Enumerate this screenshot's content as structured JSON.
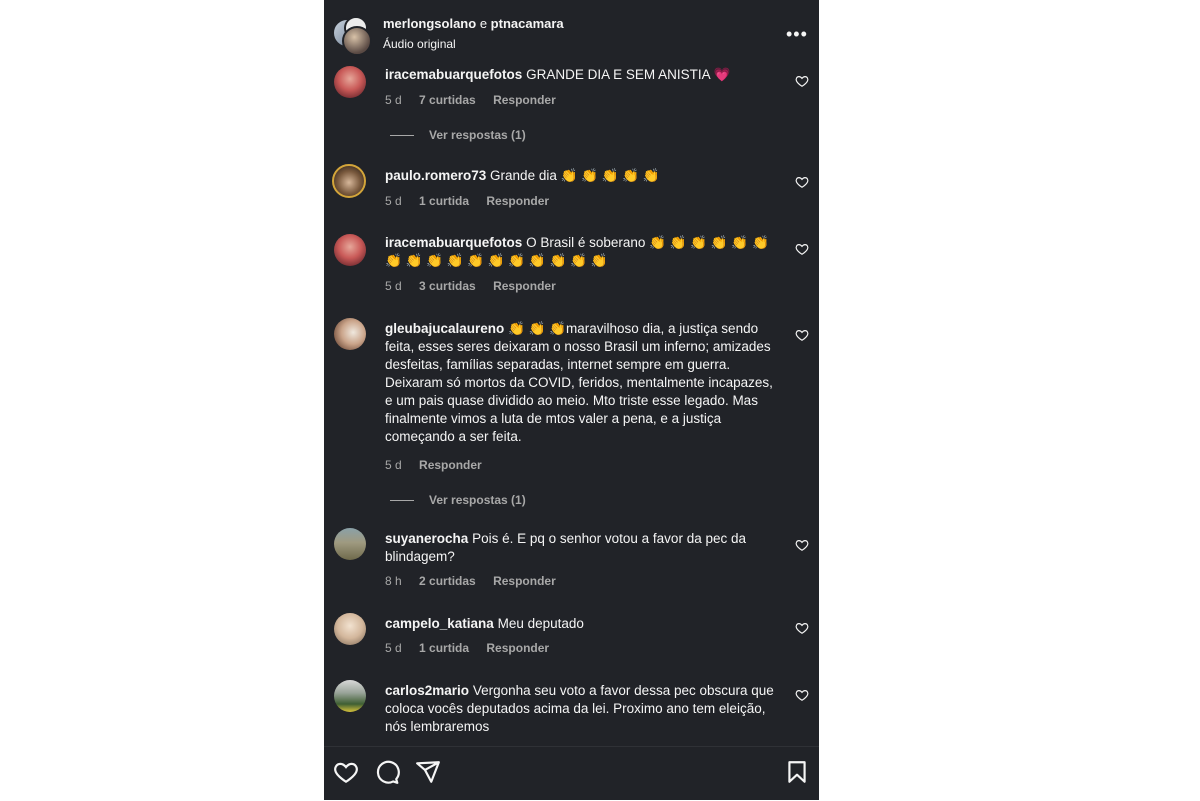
{
  "header": {
    "user1": "merlongsolano",
    "conjunction": "e",
    "user2": "ptnacamara",
    "audio": "Áudio original"
  },
  "comments": [
    {
      "user": "iracemabuarquefotos",
      "text": "GRANDE DIA E SEM ANISTIA",
      "emoji": "💗",
      "age": "5 d",
      "likes": "7 curtidas",
      "reply": "Responder",
      "view_replies": "Ver respostas (1)"
    },
    {
      "user": "paulo.romero73",
      "text": "Grande dia",
      "emoji": "👏 👏 👏 👏 👏",
      "age": "5 d",
      "likes": "1 curtida",
      "reply": "Responder"
    },
    {
      "user": "iracemabuarquefotos",
      "text": "O Brasil é soberano",
      "emoji": "👏 👏 👏 👏 👏 👏",
      "emoji2": "👏 👏 👏 👏 👏 👏 👏 👏 👏 👏 👏",
      "age": "5 d",
      "likes": "3 curtidas",
      "reply": "Responder"
    },
    {
      "user": "gleubajucalaureno",
      "emoji": "👏 👏 👏",
      "text": "maravilhoso dia, a justiça sendo feita, esses seres deixaram o nosso Brasil um inferno; amizades desfeitas, famílias separadas, internet sempre em guerra. Deixaram só mortos da COVID, feridos, mentalmente incapazes, e um pais quase dividido ao meio. Mto triste esse legado. Mas finalmente vimos a luta de mtos valer a pena, e a justiça começando a ser feita.",
      "age": "5 d",
      "reply": "Responder",
      "view_replies": "Ver respostas (1)"
    },
    {
      "user": "suyanerocha",
      "text": "Pois é. E pq o senhor votou a favor da pec da blindagem?",
      "age": "8 h",
      "likes": "2 curtidas",
      "reply": "Responder"
    },
    {
      "user": "campelo_katiana",
      "text": "Meu deputado",
      "age": "5 d",
      "likes": "1 curtida",
      "reply": "Responder"
    },
    {
      "user": "carlos2mario",
      "text": "Vergonha seu voto a favor dessa pec obscura que coloca vocês deputados acima da lei. Proximo ano tem eleição, nós lembraremos"
    }
  ],
  "icons": {
    "more": "more-options-icon",
    "like": "heart-icon",
    "comment": "comment-icon",
    "share": "send-icon",
    "save": "bookmark-icon"
  }
}
